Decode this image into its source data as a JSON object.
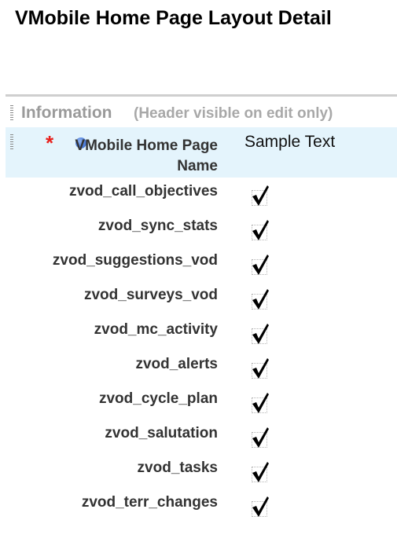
{
  "page": {
    "title": "VMobile Home Page Layout Detail"
  },
  "section": {
    "title": "Information",
    "note": "(Header visible on edit only)"
  },
  "name_field": {
    "required_mark": "*",
    "label": "VMobile Home Page Name",
    "value": "Sample Text"
  },
  "fields": [
    {
      "label": "zvod_call_objectives",
      "checked": true
    },
    {
      "label": "zvod_sync_stats",
      "checked": true
    },
    {
      "label": "zvod_suggestions_vod",
      "checked": true
    },
    {
      "label": "zvod_surveys_vod",
      "checked": true
    },
    {
      "label": "zvod_mc_activity",
      "checked": true
    },
    {
      "label": "zvod_alerts",
      "checked": true
    },
    {
      "label": "zvod_cycle_plan",
      "checked": true
    },
    {
      "label": "zvod_salutation",
      "checked": true
    },
    {
      "label": "zvod_tasks",
      "checked": true
    },
    {
      "label": "zvod_terr_changes",
      "checked": true
    }
  ],
  "colors": {
    "required": "#e8201c",
    "info_icon": "#4f7fdb",
    "highlight_row": "#e4f4fc"
  },
  "icons": {
    "checkbox": "checkmark-icon",
    "required": "required-asterisk-icon",
    "info": "info-dot-icon",
    "drag": "drag-handle-icon"
  }
}
